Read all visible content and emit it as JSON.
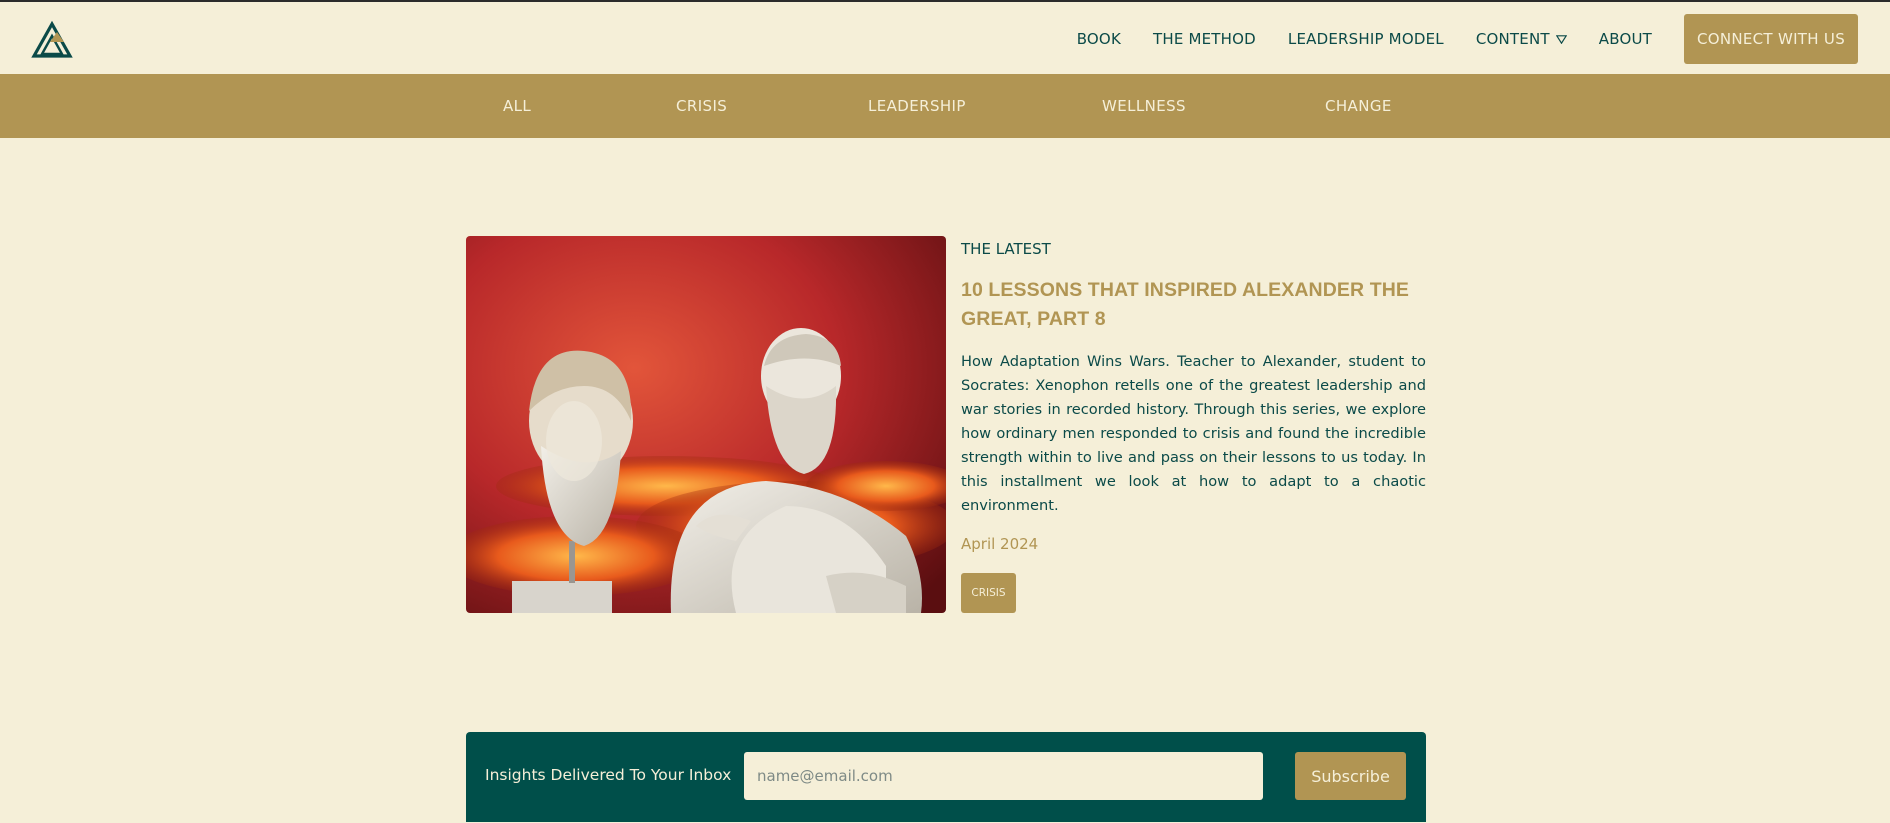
{
  "header": {
    "logo_icon": "triangle-mountain-logo-icon",
    "nav": [
      {
        "label": "BOOK"
      },
      {
        "label": "THE METHOD"
      },
      {
        "label": "LEADERSHIP MODEL"
      },
      {
        "label": "CONTENT",
        "icon": "triangle-down-icon"
      },
      {
        "label": "ABOUT"
      }
    ],
    "cta_label": "CONNECT WITH US"
  },
  "categories": [
    "ALL",
    "CRISIS",
    "LEADERSHIP",
    "WELLNESS",
    "CHANGE"
  ],
  "featured": {
    "kicker": "THE LATEST",
    "title": "10 LESSONS THAT INSPIRED ALEXANDER THE GREAT, PART 8",
    "excerpt": "How Adaptation Wins Wars. Teacher to Alexander, student to Socrates: Xenophon retells one of the greatest leadership and war stories in recorded history. Through this series, we explore how ordinary men responded to crisis and found the incredible strength within to live and pass on their lessons to us today. In this installment we look at how to adapt to a chaotic environment.",
    "date": "April 2024",
    "tag": "CRISIS"
  },
  "newsletter": {
    "label": "Insights Delivered To Your Inbox",
    "placeholder": "name@email.com",
    "button": "Subscribe"
  },
  "colors": {
    "background": "#f5efd8",
    "gold": "#b19553",
    "teal": "#004f4a",
    "text": "#0b4a48"
  }
}
